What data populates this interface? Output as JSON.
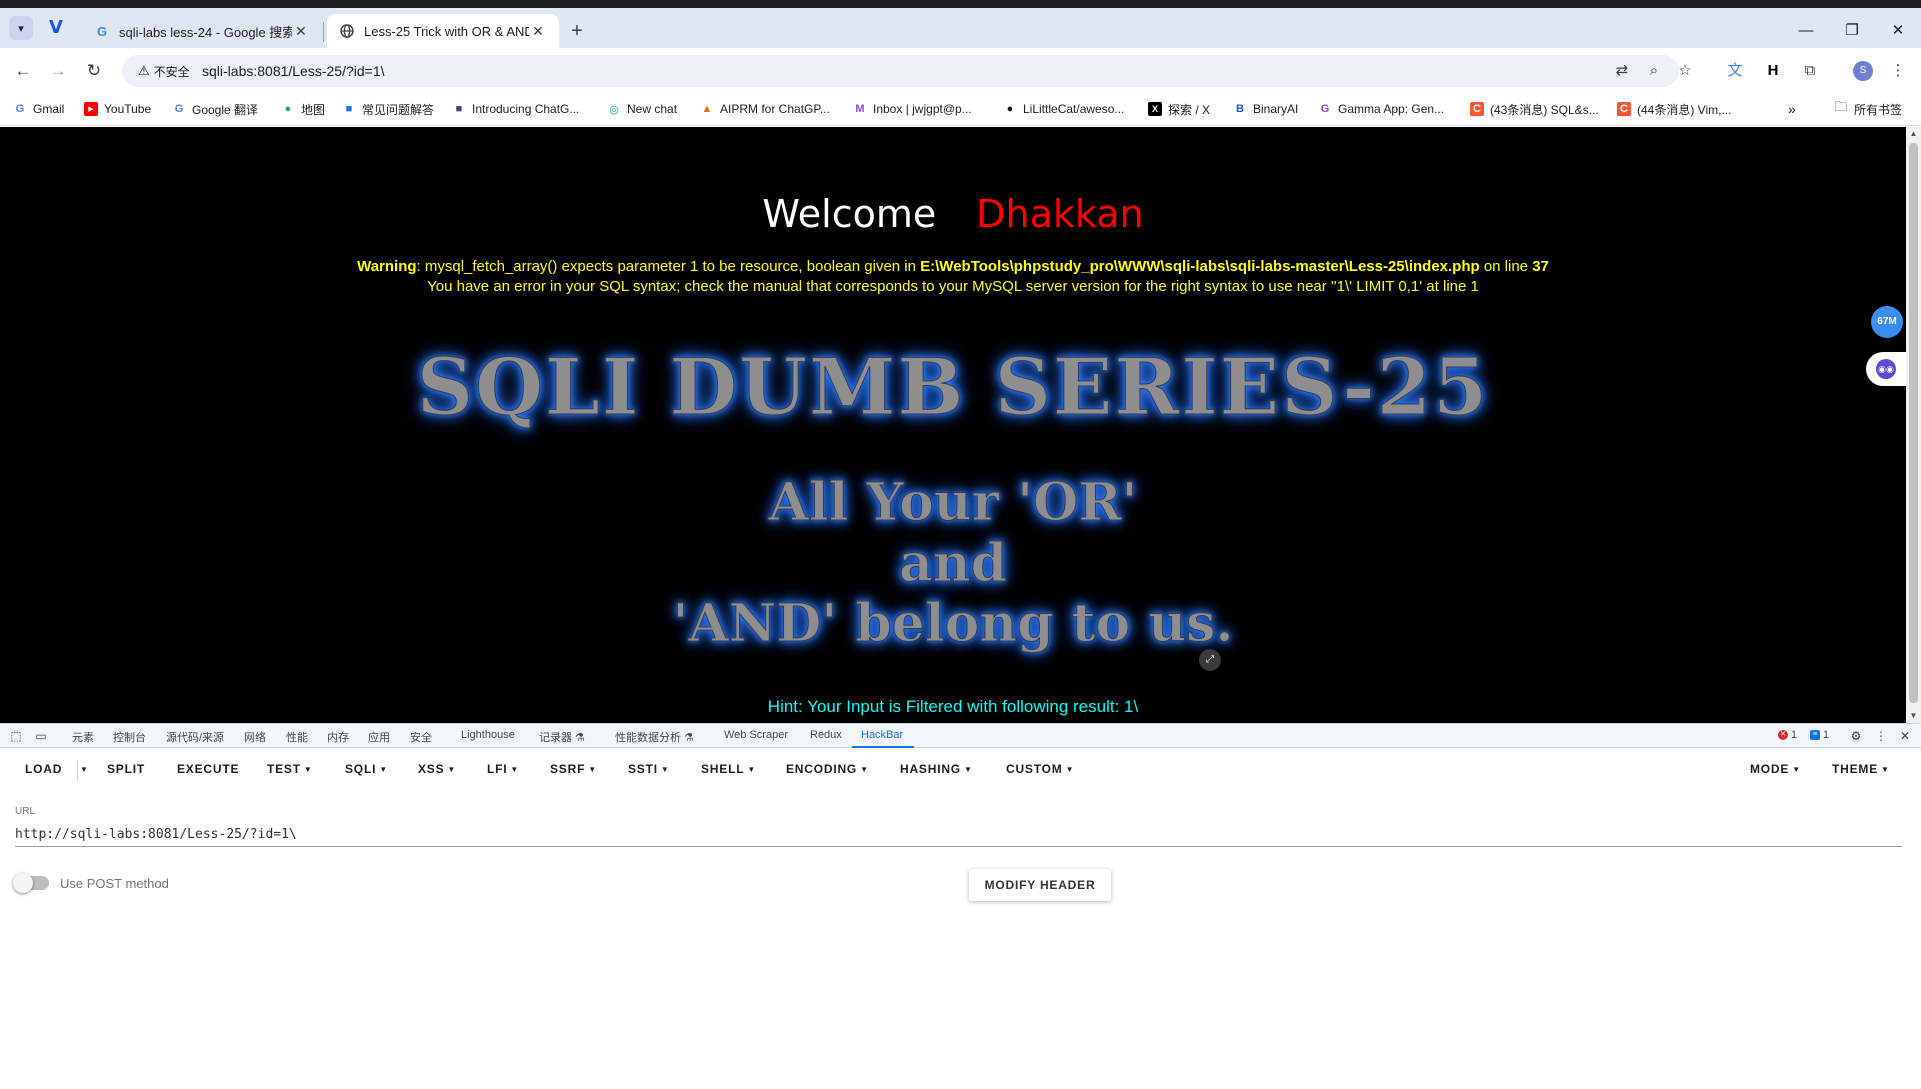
{
  "browser": {
    "tabs": [
      {
        "title": "sqli-labs less-24 - Google 搜索",
        "favicon": "G"
      },
      {
        "title": "Less-25 Trick with OR & AND",
        "favicon": "globe-icon"
      }
    ],
    "address": {
      "security_label": "不安全",
      "url": "sqli-labs:8081/Less-25/?id=1\\"
    },
    "bookmarks": [
      {
        "label": "Gmail",
        "icon": "G",
        "color": "#4285f4"
      },
      {
        "label": "YouTube",
        "icon": "▶",
        "color": "#ff0000"
      },
      {
        "label": "Google 翻译",
        "icon": "G",
        "color": "#4285f4"
      },
      {
        "label": "地图",
        "icon": "●",
        "color": "#34a853"
      },
      {
        "label": "常见问题解答",
        "icon": "■",
        "color": "#1a73e8"
      },
      {
        "label": "Introducing ChatG...",
        "icon": "■",
        "color": "#5b3a8c"
      },
      {
        "label": "New chat",
        "icon": "◎",
        "color": "#10a37f"
      },
      {
        "label": "AIPRM for ChatGP...",
        "icon": "▲",
        "color": "#e8710a"
      },
      {
        "label": "Inbox | jwjgpt@p...",
        "icon": "M",
        "color": "#7b4fe0"
      },
      {
        "label": "LiLittleCat/aweso...",
        "icon": "●",
        "color": "#1f1f1f"
      },
      {
        "label": "探索 / X",
        "icon": "X",
        "color": "#000000"
      },
      {
        "label": "BinaryAI",
        "icon": "B",
        "color": "#1a56db"
      },
      {
        "label": "Gamma App: Gen...",
        "icon": "G",
        "color": "#8a3ffc"
      },
      {
        "label": "(43条消息) SQL&s...",
        "icon": "C",
        "color": "#fc5531"
      },
      {
        "label": "(44条消息) Vim,...",
        "icon": "C",
        "color": "#fc5531"
      }
    ],
    "bookmarks_folder": "所有书签"
  },
  "page": {
    "welcome": "Welcome",
    "name": "Dhakkan",
    "warning_label": "Warning",
    "warning_text": ": mysql_fetch_array() expects parameter 1 to be resource, boolean given in ",
    "warning_path": "E:\\WebTools\\phpstudy_pro\\WWW\\sqli-labs\\sqli-labs-master\\Less-25\\index.php",
    "warning_on_line": " on line ",
    "warning_line": "37",
    "sql_error": "You have an error in your SQL syntax; check the manual that corresponds to your MySQL server version for the right syntax to use near ''1\\' LIMIT 0,1' at line 1",
    "title": "SQLI DUMB SERIES-25",
    "subtitle_1": "All Your 'OR'",
    "subtitle_2": "and",
    "subtitle_3": "'AND' belong to us.",
    "hint": "Hint: Your Input is Filtered with following result: 1\\"
  },
  "side_widgets": {
    "badge": "67M"
  },
  "devtools": {
    "tabs": [
      "元素",
      "控制台",
      "源代码/来源",
      "网络",
      "性能",
      "内存",
      "应用",
      "安全",
      "Lighthouse",
      "记录器 ⚗",
      "性能数据分析 ⚗",
      "Web Scraper",
      "Redux",
      "HackBar"
    ],
    "active_tab": "HackBar",
    "error_count": "1",
    "message_count": "1"
  },
  "hackbar": {
    "menu": {
      "load": "LOAD",
      "split": "SPLIT",
      "execute": "EXECUTE",
      "test": "TEST",
      "sqli": "SQLI",
      "xss": "XSS",
      "lfi": "LFI",
      "ssrf": "SSRF",
      "ssti": "SSTI",
      "shell": "SHELL",
      "encoding": "ENCODING",
      "hashing": "HASHING",
      "custom": "CUSTOM",
      "mode": "MODE",
      "theme": "THEME"
    },
    "url_label": "URL",
    "url_value": "http://sqli-labs:8081/Less-25/?id=1\\",
    "post_label": "Use POST method",
    "modify_header": "MODIFY HEADER"
  }
}
